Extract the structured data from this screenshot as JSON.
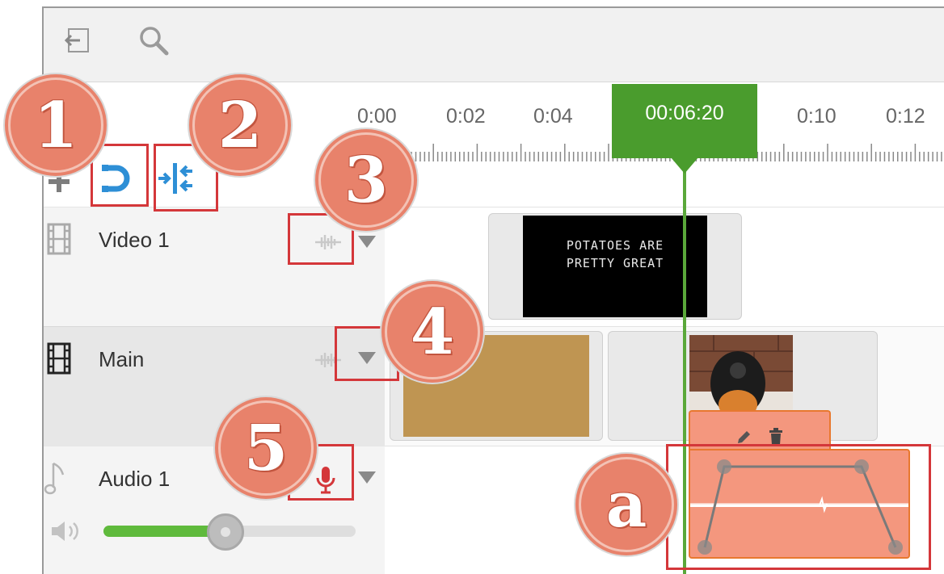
{
  "toolbar": {
    "back_icon": "exit-icon",
    "search_icon": "search-icon"
  },
  "ruler": {
    "ticks": [
      "0:00",
      "0:02",
      "0:04",
      "0:10",
      "0:12"
    ],
    "playhead_time": "00:06:20"
  },
  "edit_tools": {
    "add_icon": "plus-icon",
    "snap_icon": "magnet-icon",
    "split_icon": "split-icon"
  },
  "tracks": [
    {
      "label": "Video 1",
      "icon": "film-icon"
    },
    {
      "label": "Main",
      "icon": "film-icon"
    },
    {
      "label": "Audio 1",
      "icon": "music-note-icon"
    }
  ],
  "clips": {
    "caption_line1": "POTATOES ARE",
    "caption_line2": "PRETTY GREAT",
    "colors": {
      "clip_bg": "#e9e9e9",
      "brown_clip": "#bf9552",
      "audio_clip": "#f4977e",
      "audio_border": "#e8782f"
    }
  },
  "audio": {
    "volume_level": 0.5,
    "volume_icon": "speaker-icon",
    "mic_icon": "microphone-icon"
  },
  "badges": [
    "1",
    "2",
    "3",
    "4",
    "5",
    "a"
  ],
  "colors": {
    "accent_green": "#4a9c2d",
    "annotation_red": "#d4373a",
    "badge_salmon": "#e8826b"
  }
}
